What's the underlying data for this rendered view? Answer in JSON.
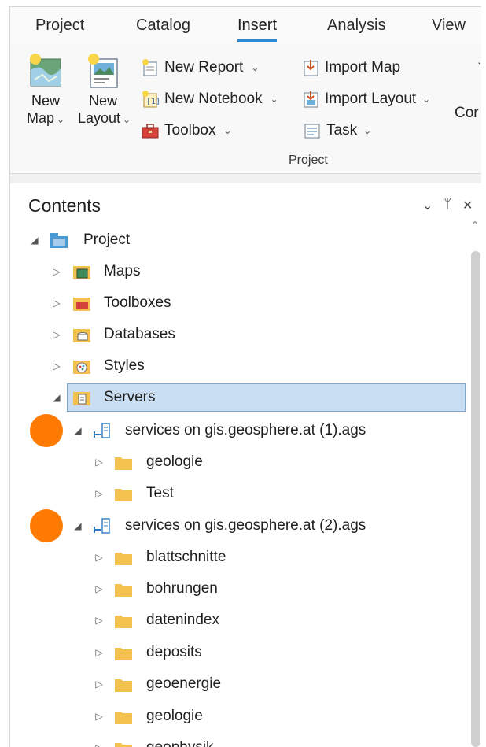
{
  "ribbon": {
    "tabs": [
      "Project",
      "Catalog",
      "Insert",
      "Analysis",
      "View"
    ],
    "active_tab": "Insert",
    "new_map": {
      "line1": "New",
      "line2": "Map"
    },
    "new_layout": {
      "line1": "New",
      "line2": "Layout"
    },
    "commands": {
      "new_report": "New Report",
      "new_notebook": "New Notebook",
      "toolbox": "Toolbox",
      "import_map": "Import Map",
      "import_layout": "Import Layout",
      "task": "Task"
    },
    "group_label": "Project",
    "truncated_label": "Cor"
  },
  "contents": {
    "title": "Contents",
    "project": "Project",
    "project_items": [
      "Maps",
      "Toolboxes",
      "Databases",
      "Styles",
      "Servers"
    ],
    "servers": [
      {
        "label": "services on gis.geosphere.at (1).ags",
        "folders": [
          "geologie",
          "Test"
        ]
      },
      {
        "label": "services on gis.geosphere.at (2).ags",
        "folders": [
          "blattschnitte",
          "bohrungen",
          "datenindex",
          "deposits",
          "geoenergie",
          "geologie",
          "geophysik"
        ]
      }
    ]
  },
  "colors": {
    "accent": "#2b8ad3",
    "selection": "#c9def2",
    "marker": "#ff7a00",
    "folder": "#f2c14e"
  }
}
